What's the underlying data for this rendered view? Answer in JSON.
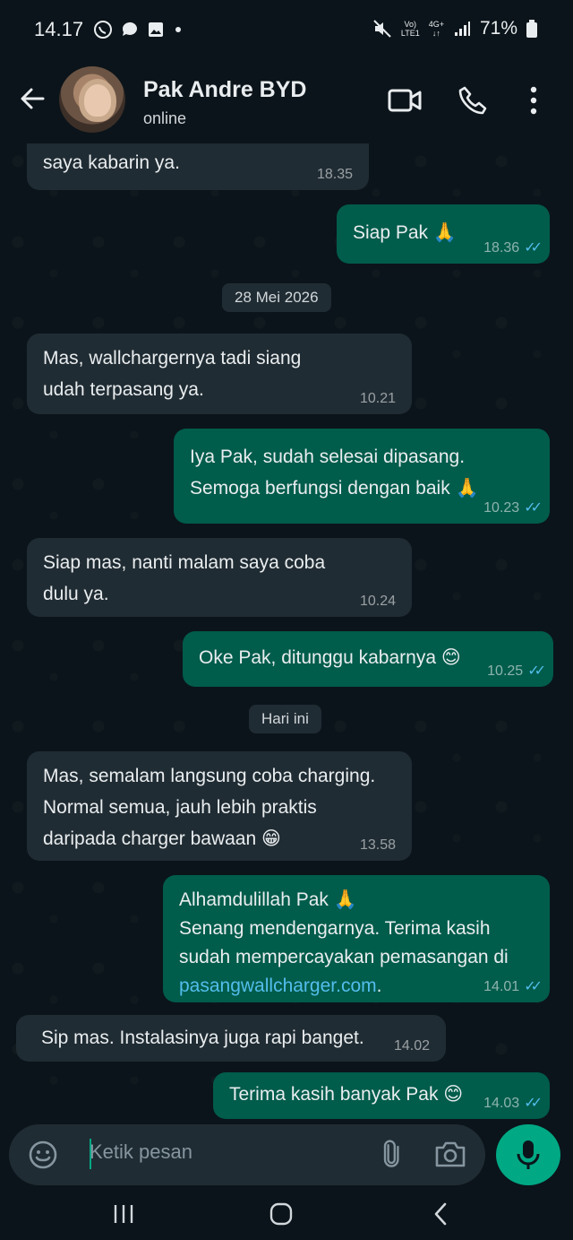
{
  "status_bar": {
    "time": "14.17",
    "network_top": "Vo)",
    "network_bottom": "LTE1",
    "net_type_top": "4G+",
    "net_type_bottom": "↓↑",
    "battery": "71%"
  },
  "header": {
    "contact_name": "Pak Andre BYD",
    "status": "online"
  },
  "messages": [
    {
      "dir": "in",
      "lines": [
        "saya kabarin ya."
      ],
      "time": "18.35"
    },
    {
      "dir": "out",
      "lines": [
        "Siap Pak 🙏"
      ],
      "time": "18.36"
    },
    {
      "dir": "in",
      "lines": [
        "Mas, wallchargernya tadi siang",
        "udah terpasang ya."
      ],
      "time": "10.21"
    },
    {
      "dir": "out",
      "lines": [
        "Iya Pak, sudah selesai dipasang.",
        "Semoga berfungsi dengan baik 🙏"
      ],
      "time": "10.23"
    },
    {
      "dir": "in",
      "lines": [
        "Siap mas, nanti malam saya coba",
        "dulu ya."
      ],
      "time": "10.24"
    },
    {
      "dir": "out",
      "lines": [
        "Oke Pak, ditunggu kabarnya 😊"
      ],
      "time": "10.25"
    },
    {
      "dir": "in",
      "lines": [
        "Mas, semalam langsung coba charging.",
        "Normal semua, jauh lebih praktis",
        "daripada charger bawaan 😁"
      ],
      "time": "13.58"
    },
    {
      "dir": "out",
      "lines": [
        "Alhamdulillah Pak 🙏",
        "Senang mendengarnya. Terima kasih",
        "sudah mempercayakan pemasangan di"
      ],
      "link": "pasangwallcharger.com",
      "link_suffix": ".",
      "time": "14.01"
    },
    {
      "dir": "in",
      "lines": [
        "Sip mas. Instalasinya juga rapi banget."
      ],
      "time": "14.02"
    },
    {
      "dir": "out",
      "lines": [
        "Terima kasih banyak Pak 😊"
      ],
      "time": "14.03"
    }
  ],
  "date_chips": [
    "28 Mei 2026",
    "Hari ini"
  ],
  "composer": {
    "placeholder": "Ketik pesan"
  },
  "icons": {
    "back": "arrow-left-icon",
    "video": "video-call-icon",
    "call": "phone-icon",
    "menu": "more-vert-icon",
    "emoji": "emoji-icon",
    "attach": "paperclip-icon",
    "camera": "camera-icon",
    "mic": "mic-icon"
  },
  "colors": {
    "background": "#0b141a",
    "incoming": "#202c33",
    "outgoing": "#005c4b",
    "accent": "#00a884",
    "read_ticks": "#53bdeb"
  }
}
